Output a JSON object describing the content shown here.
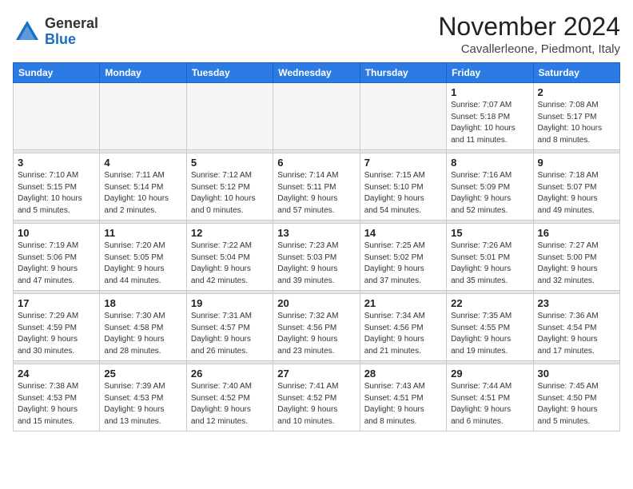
{
  "header": {
    "logo_general": "General",
    "logo_blue": "Blue",
    "month_title": "November 2024",
    "location": "Cavallerleone, Piedmont, Italy"
  },
  "weekdays": [
    "Sunday",
    "Monday",
    "Tuesday",
    "Wednesday",
    "Thursday",
    "Friday",
    "Saturday"
  ],
  "weeks": [
    [
      {
        "day": "",
        "info": ""
      },
      {
        "day": "",
        "info": ""
      },
      {
        "day": "",
        "info": ""
      },
      {
        "day": "",
        "info": ""
      },
      {
        "day": "",
        "info": ""
      },
      {
        "day": "1",
        "info": "Sunrise: 7:07 AM\nSunset: 5:18 PM\nDaylight: 10 hours\nand 11 minutes."
      },
      {
        "day": "2",
        "info": "Sunrise: 7:08 AM\nSunset: 5:17 PM\nDaylight: 10 hours\nand 8 minutes."
      }
    ],
    [
      {
        "day": "3",
        "info": "Sunrise: 7:10 AM\nSunset: 5:15 PM\nDaylight: 10 hours\nand 5 minutes."
      },
      {
        "day": "4",
        "info": "Sunrise: 7:11 AM\nSunset: 5:14 PM\nDaylight: 10 hours\nand 2 minutes."
      },
      {
        "day": "5",
        "info": "Sunrise: 7:12 AM\nSunset: 5:12 PM\nDaylight: 10 hours\nand 0 minutes."
      },
      {
        "day": "6",
        "info": "Sunrise: 7:14 AM\nSunset: 5:11 PM\nDaylight: 9 hours\nand 57 minutes."
      },
      {
        "day": "7",
        "info": "Sunrise: 7:15 AM\nSunset: 5:10 PM\nDaylight: 9 hours\nand 54 minutes."
      },
      {
        "day": "8",
        "info": "Sunrise: 7:16 AM\nSunset: 5:09 PM\nDaylight: 9 hours\nand 52 minutes."
      },
      {
        "day": "9",
        "info": "Sunrise: 7:18 AM\nSunset: 5:07 PM\nDaylight: 9 hours\nand 49 minutes."
      }
    ],
    [
      {
        "day": "10",
        "info": "Sunrise: 7:19 AM\nSunset: 5:06 PM\nDaylight: 9 hours\nand 47 minutes."
      },
      {
        "day": "11",
        "info": "Sunrise: 7:20 AM\nSunset: 5:05 PM\nDaylight: 9 hours\nand 44 minutes."
      },
      {
        "day": "12",
        "info": "Sunrise: 7:22 AM\nSunset: 5:04 PM\nDaylight: 9 hours\nand 42 minutes."
      },
      {
        "day": "13",
        "info": "Sunrise: 7:23 AM\nSunset: 5:03 PM\nDaylight: 9 hours\nand 39 minutes."
      },
      {
        "day": "14",
        "info": "Sunrise: 7:25 AM\nSunset: 5:02 PM\nDaylight: 9 hours\nand 37 minutes."
      },
      {
        "day": "15",
        "info": "Sunrise: 7:26 AM\nSunset: 5:01 PM\nDaylight: 9 hours\nand 35 minutes."
      },
      {
        "day": "16",
        "info": "Sunrise: 7:27 AM\nSunset: 5:00 PM\nDaylight: 9 hours\nand 32 minutes."
      }
    ],
    [
      {
        "day": "17",
        "info": "Sunrise: 7:29 AM\nSunset: 4:59 PM\nDaylight: 9 hours\nand 30 minutes."
      },
      {
        "day": "18",
        "info": "Sunrise: 7:30 AM\nSunset: 4:58 PM\nDaylight: 9 hours\nand 28 minutes."
      },
      {
        "day": "19",
        "info": "Sunrise: 7:31 AM\nSunset: 4:57 PM\nDaylight: 9 hours\nand 26 minutes."
      },
      {
        "day": "20",
        "info": "Sunrise: 7:32 AM\nSunset: 4:56 PM\nDaylight: 9 hours\nand 23 minutes."
      },
      {
        "day": "21",
        "info": "Sunrise: 7:34 AM\nSunset: 4:56 PM\nDaylight: 9 hours\nand 21 minutes."
      },
      {
        "day": "22",
        "info": "Sunrise: 7:35 AM\nSunset: 4:55 PM\nDaylight: 9 hours\nand 19 minutes."
      },
      {
        "day": "23",
        "info": "Sunrise: 7:36 AM\nSunset: 4:54 PM\nDaylight: 9 hours\nand 17 minutes."
      }
    ],
    [
      {
        "day": "24",
        "info": "Sunrise: 7:38 AM\nSunset: 4:53 PM\nDaylight: 9 hours\nand 15 minutes."
      },
      {
        "day": "25",
        "info": "Sunrise: 7:39 AM\nSunset: 4:53 PM\nDaylight: 9 hours\nand 13 minutes."
      },
      {
        "day": "26",
        "info": "Sunrise: 7:40 AM\nSunset: 4:52 PM\nDaylight: 9 hours\nand 12 minutes."
      },
      {
        "day": "27",
        "info": "Sunrise: 7:41 AM\nSunset: 4:52 PM\nDaylight: 9 hours\nand 10 minutes."
      },
      {
        "day": "28",
        "info": "Sunrise: 7:43 AM\nSunset: 4:51 PM\nDaylight: 9 hours\nand 8 minutes."
      },
      {
        "day": "29",
        "info": "Sunrise: 7:44 AM\nSunset: 4:51 PM\nDaylight: 9 hours\nand 6 minutes."
      },
      {
        "day": "30",
        "info": "Sunrise: 7:45 AM\nSunset: 4:50 PM\nDaylight: 9 hours\nand 5 minutes."
      }
    ]
  ]
}
